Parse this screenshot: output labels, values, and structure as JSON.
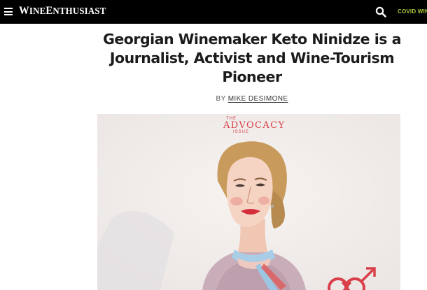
{
  "header": {
    "logo": "WINE ENTHUSIAST",
    "logo_first": "W",
    "logo_second": "INE",
    "logo_third": "E",
    "logo_fourth": "NTHUSIAST",
    "nav_link": "COVID WIN"
  },
  "article": {
    "title": "Georgian Winemaker Keto Ninidze is a Journalist, Activist and Wine-Tourism Pioneer",
    "byline_prefix": "BY",
    "author": "MIKE DESIMONE"
  },
  "hero": {
    "badge_top": "THE",
    "badge_main": "ADVOCACY",
    "badge_bottom": "ISSUE"
  },
  "colors": {
    "header_bg": "#000000",
    "covid_link": "#a8c73a",
    "badge_red": "#d9404a"
  },
  "icons": [
    "hamburger-menu-icon",
    "search-icon",
    "gender-symbol-icon"
  ]
}
